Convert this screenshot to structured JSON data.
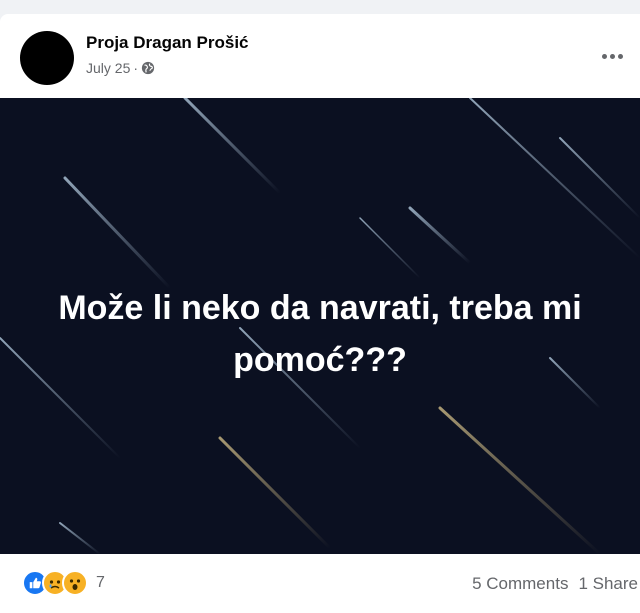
{
  "post": {
    "author": "Proja Dragan Prošić",
    "date": "July 25",
    "separator": "·",
    "privacy_icon": "globe-icon",
    "image_text": "Može li neko da navrati, treba mi pomoć???",
    "reaction_icons": [
      "like-icon",
      "sad-icon",
      "wow-icon"
    ],
    "reaction_count": "7",
    "comments": "5 Comments",
    "shares": "1 Share"
  },
  "colors": {
    "background": "#f0f2f5",
    "image_background": "#0b1021",
    "like": "#1877f2",
    "emoji": "#f7b125",
    "meta_text": "#65676b"
  }
}
